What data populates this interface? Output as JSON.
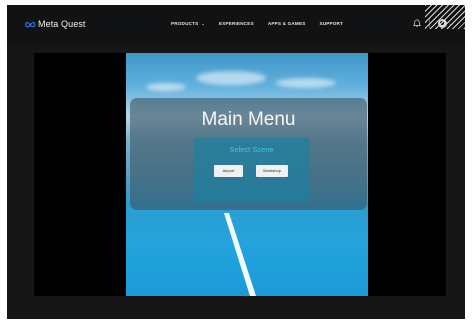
{
  "nav": {
    "logo_text": "Meta Quest",
    "links": [
      {
        "label": "PRODUCTS",
        "has_dropdown": true
      },
      {
        "label": "EXPERIENCES",
        "has_dropdown": false
      },
      {
        "label": "APPS & GAMES",
        "has_dropdown": false
      },
      {
        "label": "SUPPORT",
        "has_dropdown": false
      }
    ],
    "icons": [
      "bell-icon",
      "account-icon",
      "chevron-down-icon"
    ]
  },
  "scene": {
    "menu_title": "Main Menu",
    "select_label": "Select Scene",
    "buttons": [
      "Airport",
      "Workshop"
    ]
  },
  "colors": {
    "page_bg": "#161616",
    "nav_bg": "#111214",
    "accent_text": "#47c9ea",
    "sky_blue": "#22a3dc"
  }
}
